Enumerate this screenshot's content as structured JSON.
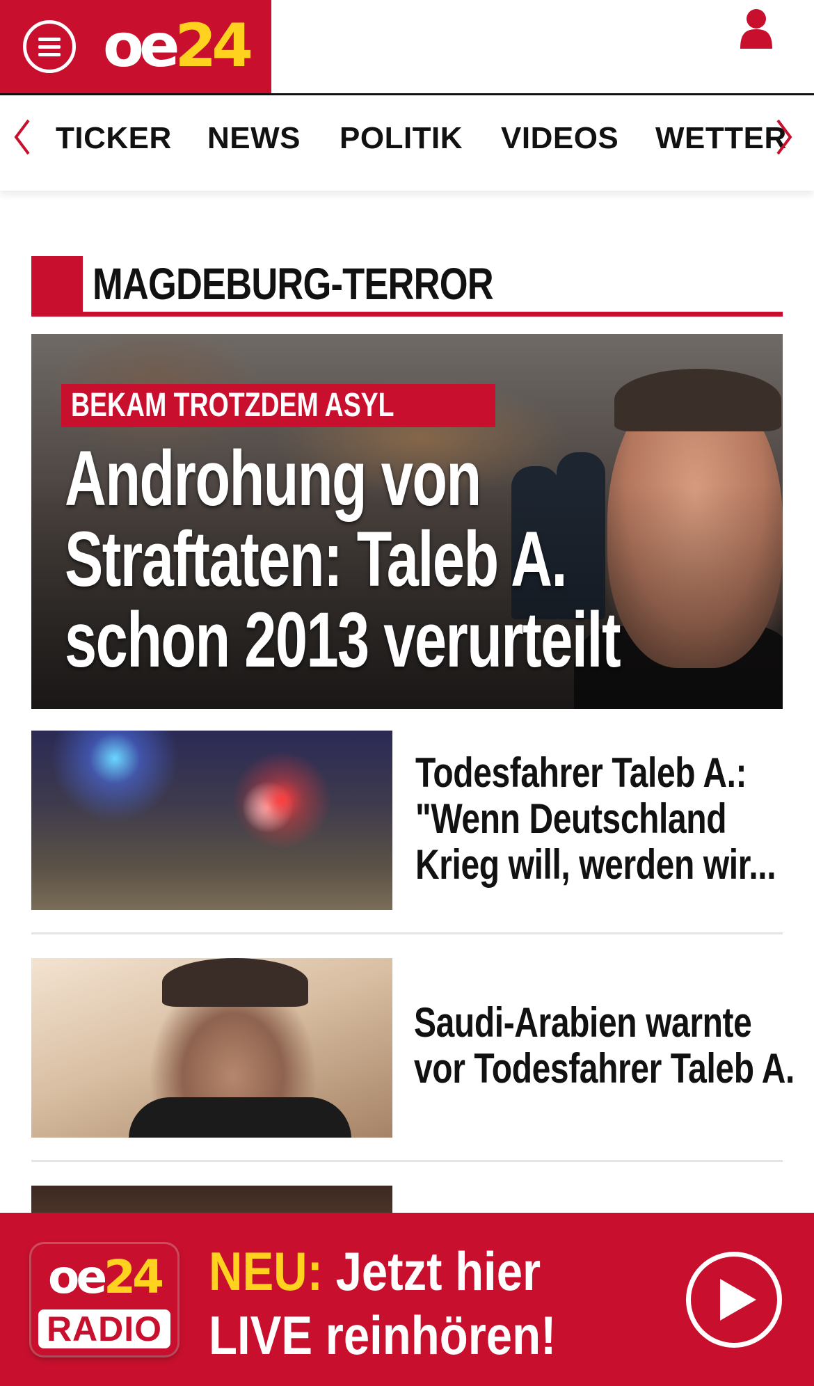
{
  "header": {
    "logo": {
      "part1": "oe",
      "part2": "24"
    },
    "menu_icon": "hamburger-menu-icon",
    "user_icon": "user-icon"
  },
  "nav": {
    "items": [
      {
        "label": "TICKER"
      },
      {
        "label": "NEWS"
      },
      {
        "label": "POLITIK"
      },
      {
        "label": "VIDEOS"
      },
      {
        "label": "WETTER"
      }
    ]
  },
  "section": {
    "title": "MAGDEBURG-TERROR"
  },
  "hero": {
    "kicker": "BEKAM TROTZDEM ASYL",
    "title": "Androhung von Straftaten: Taleb A. schon 2013 verurteilt"
  },
  "articles": [
    {
      "title": "Todesfahrer Taleb A.: \"Wenn Deutschland Krieg will, werden wir..."
    },
    {
      "title": "Saudi-Arabien warnte vor Todesfahrer Taleb A."
    }
  ],
  "radio": {
    "logo_part1": "oe",
    "logo_part2": "24",
    "logo_radio": "RADIO",
    "neu": "NEU:",
    "line1": "Jetzt hier",
    "line2": "LIVE reinhören!",
    "play_icon": "play-icon"
  },
  "colors": {
    "brand_red": "#c8102e",
    "brand_yellow": "#ffd21f"
  }
}
